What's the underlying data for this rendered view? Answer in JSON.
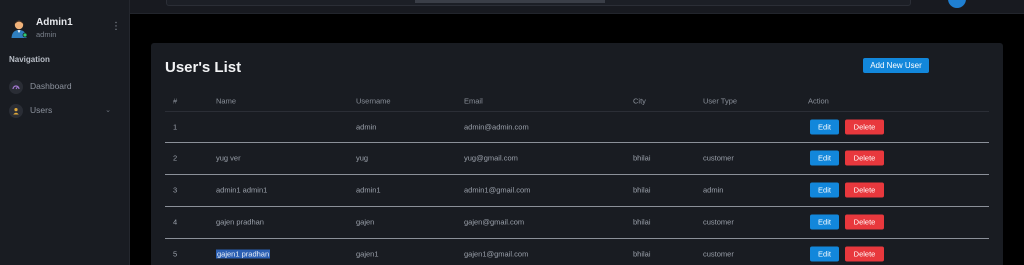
{
  "sidebar": {
    "profile": {
      "name": "Admin1",
      "role": "admin"
    },
    "nav_title": "Navigation",
    "items": [
      {
        "label": "Dashboard",
        "icon": "dashboard-icon"
      },
      {
        "label": "Users",
        "icon": "user-icon"
      }
    ]
  },
  "main": {
    "title": "User's List",
    "add_button": "Add New User",
    "columns": [
      "#",
      "Name",
      "Username",
      "Email",
      "City",
      "User Type",
      "Action"
    ],
    "rows": [
      {
        "num": "1",
        "name": "",
        "username": "admin",
        "email": "admin@admin.com",
        "city": "",
        "type": ""
      },
      {
        "num": "2",
        "name": "yug ver",
        "username": "yug",
        "email": "yug@gmail.com",
        "city": "bhilai",
        "type": "customer"
      },
      {
        "num": "3",
        "name": "admin1 admin1",
        "username": "admin1",
        "email": "admin1@gmail.com",
        "city": "bhilai",
        "type": "admin"
      },
      {
        "num": "4",
        "name": "gajen pradhan",
        "username": "gajen",
        "email": "gajen@gmail.com",
        "city": "bhilai",
        "type": "customer"
      },
      {
        "num": "5",
        "name": "gajen1 pradhan",
        "username": "gajen1",
        "email": "gajen1@gmail.com",
        "city": "bhilai",
        "type": "customer"
      }
    ],
    "edit_label": "Edit",
    "delete_label": "Delete"
  },
  "colors": {
    "primary": "#1287db",
    "danger": "#e8383d",
    "background": "#000000",
    "panel": "#191c22"
  }
}
